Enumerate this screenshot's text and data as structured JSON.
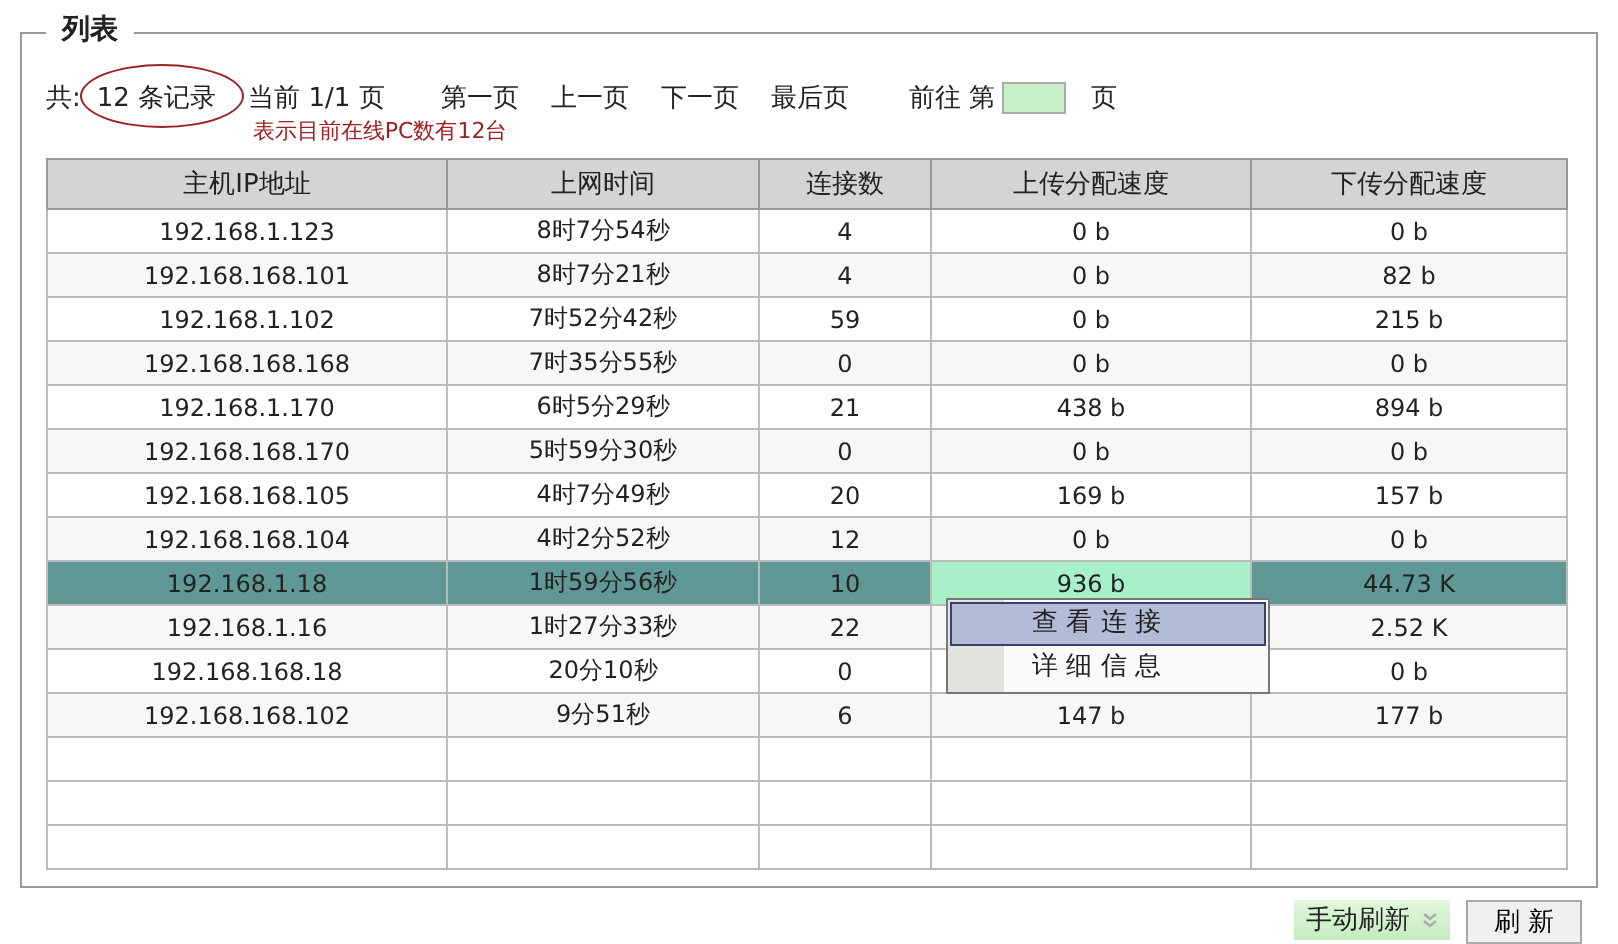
{
  "legend": "列表",
  "pager": {
    "total_prefix": "共:",
    "total": "12 条记录",
    "current": "当前 1/1 页",
    "first": "第一页",
    "prev": "上一页",
    "next": "下一页",
    "last": "最后页",
    "goto_prefix": "前往 第",
    "goto_suffix": "页"
  },
  "annotation": {
    "note": "表示目前在线PC数有12台",
    "color": "#a02020"
  },
  "table": {
    "columns": [
      "主机IP地址",
      "上网时间",
      "连接数",
      "上传分配速度",
      "下传分配速度"
    ],
    "rows": [
      {
        "cells": [
          "192.168.1.123",
          "8时7分54秒",
          "4",
          "0 b",
          "0 b"
        ],
        "selected": false
      },
      {
        "cells": [
          "192.168.168.101",
          "8时7分21秒",
          "4",
          "0 b",
          "82 b"
        ],
        "selected": false
      },
      {
        "cells": [
          "192.168.1.102",
          "7时52分42秒",
          "59",
          "0 b",
          "215 b"
        ],
        "selected": false
      },
      {
        "cells": [
          "192.168.168.168",
          "7时35分55秒",
          "0",
          "0 b",
          "0 b"
        ],
        "selected": false
      },
      {
        "cells": [
          "192.168.1.170",
          "6时5分29秒",
          "21",
          "438 b",
          "894 b"
        ],
        "selected": false
      },
      {
        "cells": [
          "192.168.168.170",
          "5时59分30秒",
          "0",
          "0 b",
          "0 b"
        ],
        "selected": false
      },
      {
        "cells": [
          "192.168.168.105",
          "4时7分49秒",
          "20",
          "169 b",
          "157 b"
        ],
        "selected": false
      },
      {
        "cells": [
          "192.168.168.104",
          "4时2分52秒",
          "12",
          "0 b",
          "0 b"
        ],
        "selected": false
      },
      {
        "cells": [
          "192.168.1.18",
          "1时59分56秒",
          "10",
          "936 b",
          "44.73 K"
        ],
        "selected": true
      },
      {
        "cells": [
          "192.168.1.16",
          "1时27分33秒",
          "22",
          null,
          "2.52 K"
        ],
        "selected": false
      },
      {
        "cells": [
          "192.168.168.18",
          "20分10秒",
          "0",
          null,
          "0 b"
        ],
        "selected": false
      },
      {
        "cells": [
          "192.168.168.102",
          "9分51秒",
          "6",
          "147 b",
          "177 b"
        ],
        "selected": false
      }
    ]
  },
  "context_menu": {
    "items": [
      {
        "label": "查 看 连 接",
        "selected": true
      },
      {
        "label": "详 细 信 息",
        "selected": false
      }
    ]
  },
  "footer": {
    "refresh_mode": "手动刷新",
    "refresh_button": "刷 新"
  }
}
